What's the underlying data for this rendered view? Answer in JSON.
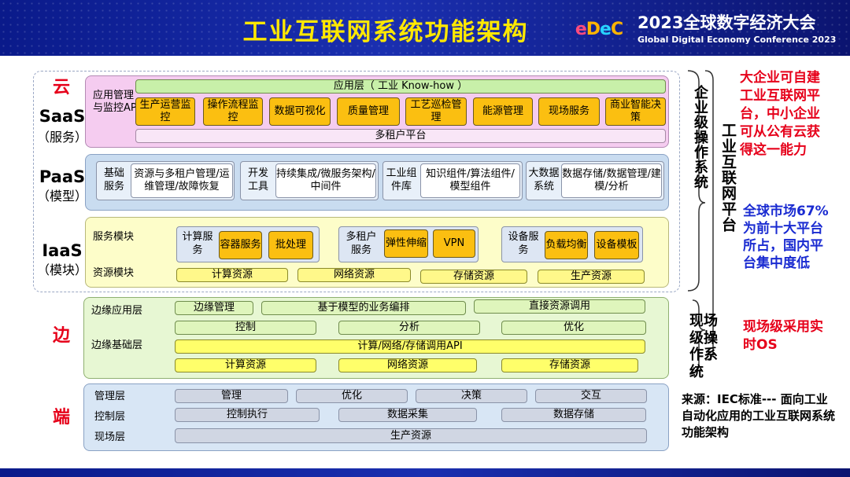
{
  "header": {
    "title": "工业互联网系统功能架构",
    "logo_parts": [
      "e",
      "D",
      "e",
      "C"
    ],
    "conference_year": "2023全球数字经济大会",
    "conference_en": "Global Digital Economy Conference 2023"
  },
  "cloud": {
    "label": "云",
    "saas": {
      "name": "SaaS",
      "sub": "（服务）",
      "side_label": "应用管理与监控APP",
      "app_layer": "应用层（ 工业 Know-how ）",
      "apps": [
        "生产运营监控",
        "操作流程监控",
        "数据可视化",
        "质量管理",
        "工艺巡检管理",
        "能源管理",
        "现场服务",
        "商业智能决策"
      ],
      "multi_tenant": "多租户平台"
    },
    "paas": {
      "name": "PaaS",
      "sub": "（模型）",
      "groups": [
        {
          "title": "基础服务",
          "detail": "资源与多租户管理/运维管理/故障恢复"
        },
        {
          "title": "开发工具",
          "detail": "持续集成/微服务架构/中间件"
        },
        {
          "title": "工业组件库",
          "detail": "知识组件/算法组件/模型组件"
        },
        {
          "title": "大数据系统",
          "detail": "数据存储/数据管理/建模/分析"
        }
      ]
    },
    "iaas": {
      "name": "IaaS",
      "sub": "（模块）",
      "service_label": "服务模块",
      "resource_label": "资源模块",
      "service_groups": [
        {
          "title": "计算服务",
          "items": [
            "容器服务",
            "批处理"
          ]
        },
        {
          "title": "多租户服务",
          "items": [
            "弹性伸缩",
            "VPN"
          ]
        },
        {
          "title": "设备服务",
          "items": [
            "负载均衡",
            "设备模板"
          ]
        }
      ],
      "resources": [
        "计算资源",
        "网络资源",
        "存储资源",
        "生产资源"
      ]
    }
  },
  "edge": {
    "label": "边",
    "app_layer_label": "边缘应用层",
    "base_layer_label": "边缘基础层",
    "app_items": [
      "边缘管理",
      "基于模型的业务编排",
      "直接资源调用"
    ],
    "functions": [
      "控制",
      "分析",
      "优化"
    ],
    "api": "计算/网络/存储调用API",
    "resources": [
      "计算资源",
      "网络资源",
      "存储资源"
    ]
  },
  "end": {
    "label": "端",
    "rows": [
      {
        "label": "管理层",
        "items": [
          "管理",
          "优化",
          "决策",
          "交互"
        ]
      },
      {
        "label": "控制层",
        "items": [
          "控制执行",
          "数据采集",
          "数据存储"
        ]
      },
      {
        "label": "现场层",
        "items": [
          "生产资源"
        ]
      }
    ]
  },
  "brackets": {
    "enterprise_os": "企业级操作系统",
    "platform": "工业互联网平台",
    "field_os": "现场级操作系统"
  },
  "notes": {
    "big_enterprise": "大企业可自建工业互联网平台，中小企业可从公有云获得这一能力",
    "market": "全球市场67%为前十大平台所占，国内平台集中度低",
    "field": "现场级采用实时OS",
    "source": "来源：IEC标准--- 面向工业自动化应用的工业互联网系统功能架构"
  },
  "colors": {
    "title_yellow": "#ffe800",
    "header_blue": "#1a2fb0",
    "accent_red": "#e6001a",
    "note_blue": "#1a2bd1",
    "app_orange": "#fbbf11"
  }
}
